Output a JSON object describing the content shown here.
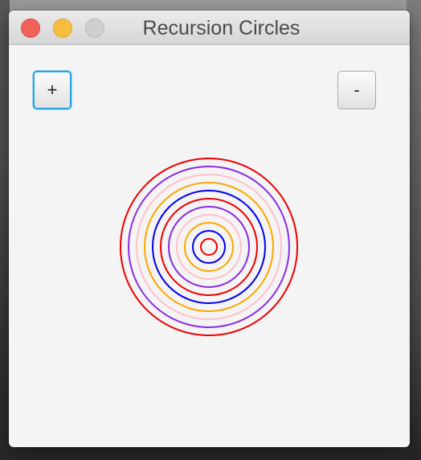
{
  "window": {
    "title": "Recursion Circles"
  },
  "controls": {
    "plus_label": "+",
    "minus_label": "-"
  },
  "circles": {
    "count": 11,
    "colors_outer_to_inner": [
      "#ee0000",
      "#8a2be2",
      "#ffc0cb",
      "#ffa500",
      "#0000ee",
      "#ee0000",
      "#8a2be2",
      "#ffc0cb",
      "#ffa500",
      "#0000ee",
      "#ee0000"
    ]
  }
}
